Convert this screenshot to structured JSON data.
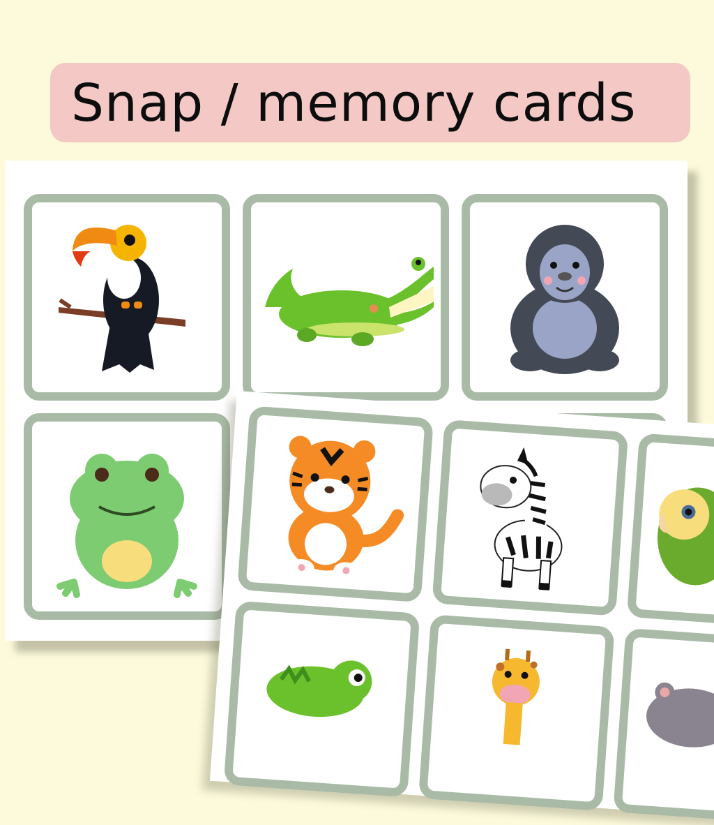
{
  "title": {
    "text": "Snap / memory cards",
    "banner_color": "#f4c9c5"
  },
  "colors": {
    "background": "#fdfadb",
    "card_border": "#a9bba7",
    "sheet": "#ffffff"
  },
  "back_sheet": {
    "cards": [
      {
        "animal": "toucan"
      },
      {
        "animal": "crocodile"
      },
      {
        "animal": "gorilla"
      },
      {
        "animal": "frog"
      }
    ]
  },
  "front_sheet": {
    "cards": [
      {
        "animal": "tiger"
      },
      {
        "animal": "zebra"
      },
      {
        "animal": "parrot"
      },
      {
        "animal": "chameleon"
      },
      {
        "animal": "giraffe"
      },
      {
        "animal": "hippo"
      }
    ]
  }
}
